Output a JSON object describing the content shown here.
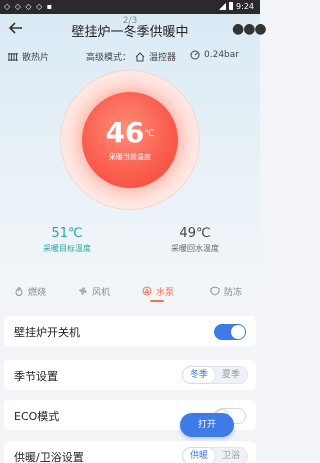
{
  "status": {
    "time": "9:24"
  },
  "header": {
    "title": "壁挂炉一冬季供暖中",
    "page_indicator": "2/3"
  },
  "info": {
    "radiator_label": "散热片",
    "mode_label": "高级模式：",
    "thermostat_label": "温控器",
    "pressure": "0.24bar"
  },
  "gauge": {
    "current_temp": "46",
    "unit": "℃",
    "label": "采暖当前温度"
  },
  "stats": {
    "target_temp": "51℃",
    "target_label": "采暖目标温度",
    "return_temp": "49℃",
    "return_label": "采暖回水温度"
  },
  "tabs": [
    {
      "label": "燃烧"
    },
    {
      "label": "风机"
    },
    {
      "label": "水泵"
    },
    {
      "label": "防冻"
    }
  ],
  "rows": {
    "power_label": "壁挂炉开关机",
    "power_on": true,
    "season_label": "季节设置",
    "season_options": [
      "冬季",
      "夏季"
    ],
    "season_selected": "冬季",
    "eco_label": "ECO模式",
    "eco_on": false,
    "heat_label": "供暖/卫浴设置",
    "heat_options": [
      "供暖",
      "卫浴"
    ],
    "heat_selected": "供暖"
  },
  "fab": {
    "label": "打开"
  },
  "colors": {
    "accent": "#3e7be6",
    "heat": "#f95b4c",
    "teal": "#26a89c",
    "tab_active": "#f47250"
  }
}
